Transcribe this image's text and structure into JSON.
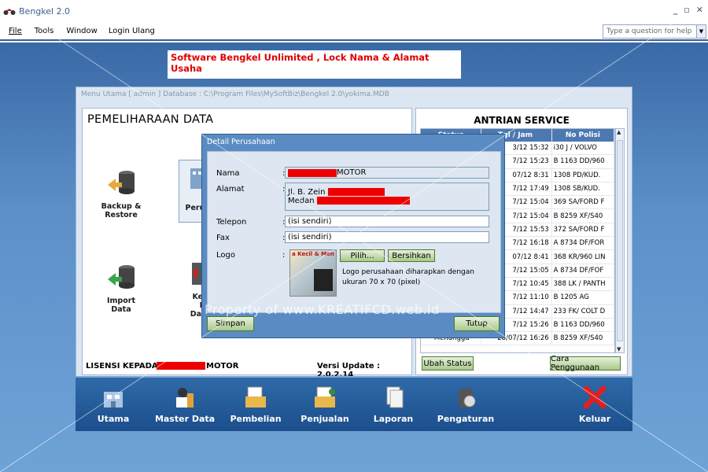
{
  "window": {
    "title": "Bengkel 2.0",
    "controls": [
      "_",
      "▫",
      "✕"
    ]
  },
  "menu": {
    "items": [
      "File",
      "Tools",
      "Window",
      "Login Ulang"
    ]
  },
  "help": {
    "placeholder": "Type a question for help"
  },
  "banner": {
    "text": "Software Bengkel Unlimited , Lock Nama & Alamat Usaha"
  },
  "main_window": {
    "title": "Menu Utama [ admin ] Database : C:\\Program Files\\MySoftBiz\\Bengkel 2.0\\yokima.MDB"
  },
  "left_panel": {
    "heading": "PEMELIHARAAN DATA",
    "tiles": [
      {
        "line1": "Backup &",
        "line2": "Restore"
      },
      {
        "line1": "D",
        "line2": "Perus"
      },
      {
        "line1": "Import",
        "line2": "Data"
      },
      {
        "line1": "Keci",
        "line2": "Pe",
        "line3": "Data"
      }
    ],
    "license_label": "LISENSI KEPADA :",
    "license_suffix": "MOTOR",
    "version": "Versi Update : 2.0.2.14"
  },
  "antrian": {
    "title": "ANTRIAN SERVICE",
    "columns": [
      "Status",
      "Tgl / Jam",
      "No Polisi"
    ],
    "rows": [
      [
        "",
        "3/12 15:32",
        "i30 J / VOLVO"
      ],
      [
        "",
        "7/12 15:23",
        "B 1163 DD/960"
      ],
      [
        "",
        "07/12 8:31",
        "1308 PD/KUD."
      ],
      [
        "",
        "7/12 17:49",
        "1308 SB/KUD."
      ],
      [
        "",
        "7/12 15:04",
        "369 SA/FORD F"
      ],
      [
        "",
        "7/12 15:04",
        "B 8259 XF/S40"
      ],
      [
        "",
        "7/12 15:53",
        "372 SA/FORD F"
      ],
      [
        "",
        "7/12 16:18",
        "A 8734 DF/FOR"
      ],
      [
        "",
        "07/12 8:41",
        "368 KR/960 LIN"
      ],
      [
        "",
        "7/12 15:05",
        "A 8734 DF/FOF"
      ],
      [
        "",
        "7/12 10:45",
        "388 LK / PANTH"
      ],
      [
        "",
        "7/12 11:10",
        "B 1205 AG"
      ],
      [
        "",
        "7/12 14:47",
        "233 FK/ COLT D"
      ],
      [
        "",
        "7/12 15:26",
        "B 1163 DD/960"
      ],
      [
        "Menunggu",
        "28/07/12 16:26",
        "B 8259 XF/S40"
      ]
    ],
    "btn_status": "Ubah Status",
    "btn_help": "Cara Penggunaan"
  },
  "taskbar": {
    "items": [
      "Utama",
      "Master Data",
      "Pembelian",
      "Penjualan",
      "Laporan",
      "Pengaturan",
      "Keluar"
    ]
  },
  "dialog": {
    "title": "Detail Perusahaan",
    "labels": {
      "nama": "Nama",
      "alamat": "Alamat",
      "telepon": "Telepon",
      "fax": "Fax",
      "logo": "Logo"
    },
    "nama_suffix": "MOTOR",
    "alamat_line1": "Jl. B. Zein",
    "alamat_line2": "Medan",
    "telepon": "(isi sendiri)",
    "fax": "(isi sendiri)",
    "logo_caption": "a Kecil & Men",
    "btn_pilih": "Pilih...",
    "btn_bersihkan": "Bersihkan",
    "logo_note": "Logo perusahaan diharapkan dengan ukuran 70 x 70 (pixel)",
    "btn_simpan": "Simpan",
    "btn_tutup": "Tutup"
  },
  "watermark": "Property of www.KREATIFCD.web.id",
  "colors": {
    "desktop": "#5d90c9",
    "taskbar": "#1c4e8c",
    "redaction": "#ef0000",
    "banner_text": "#e00000"
  }
}
